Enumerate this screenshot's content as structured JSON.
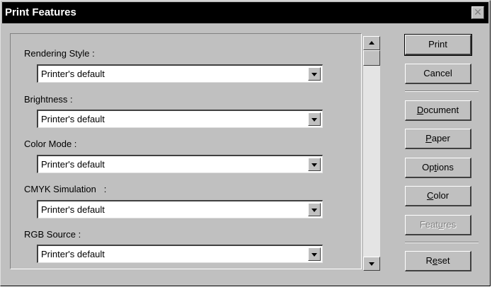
{
  "window": {
    "title": "Print Features",
    "close_glyph": "✕"
  },
  "fields": [
    {
      "label": "Rendering Style :",
      "value": "Printer's default"
    },
    {
      "label": "Brightness :",
      "value": "Printer's default"
    },
    {
      "label": "Color Mode :",
      "value": "Printer's default"
    },
    {
      "label": "CMYK Simulation   :",
      "value": "Printer's default"
    },
    {
      "label": "RGB Source :",
      "value": "Printer's default"
    }
  ],
  "buttons": {
    "print": "Print",
    "cancel": "Cancel",
    "document": {
      "pre": "",
      "key": "D",
      "post": "ocument"
    },
    "paper": {
      "pre": "",
      "key": "P",
      "post": "aper"
    },
    "options": {
      "pre": "Op",
      "key": "t",
      "post": "ions"
    },
    "color": {
      "pre": "",
      "key": "C",
      "post": "olor"
    },
    "features": {
      "pre": "Feat",
      "key": "u",
      "post": "res"
    },
    "reset": {
      "pre": "R",
      "key": "e",
      "post": "set"
    }
  }
}
